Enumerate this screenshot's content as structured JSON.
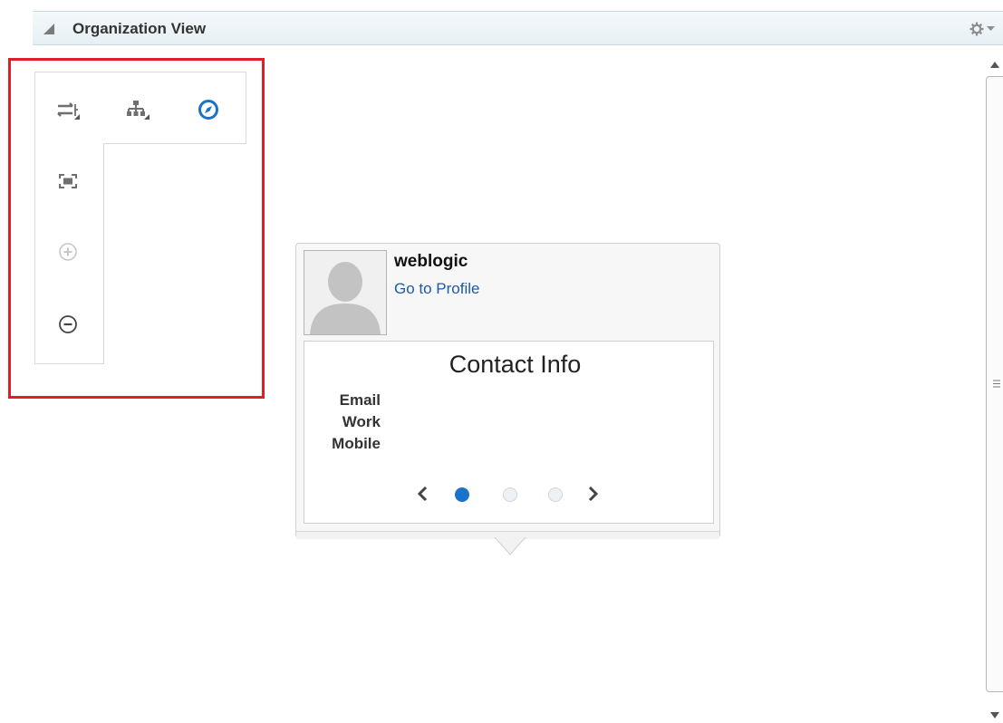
{
  "panel": {
    "title": "Organization View"
  },
  "icons": {
    "collapse": "collapse-triangle-icon",
    "settings": "gear-icon",
    "menu": "dropdown-arrow-icon"
  },
  "toolbar": {
    "tools": [
      {
        "name": "change-layout-icon"
      },
      {
        "name": "hierarchy-icon"
      },
      {
        "name": "compass-icon"
      },
      {
        "name": "fit-to-view-icon"
      },
      {
        "name": "zoom-in-icon"
      },
      {
        "name": "zoom-out-icon"
      }
    ]
  },
  "card": {
    "name": "weblogic",
    "profile_link": "Go to Profile",
    "contact": {
      "title": "Contact Info",
      "labels": [
        "Email",
        "Work",
        "Mobile"
      ]
    },
    "pager": {
      "pages": 3,
      "current": 1
    }
  },
  "colors": {
    "highlight": "#e01e26",
    "accent": "#1a72c9",
    "link": "#1a5aa8"
  }
}
